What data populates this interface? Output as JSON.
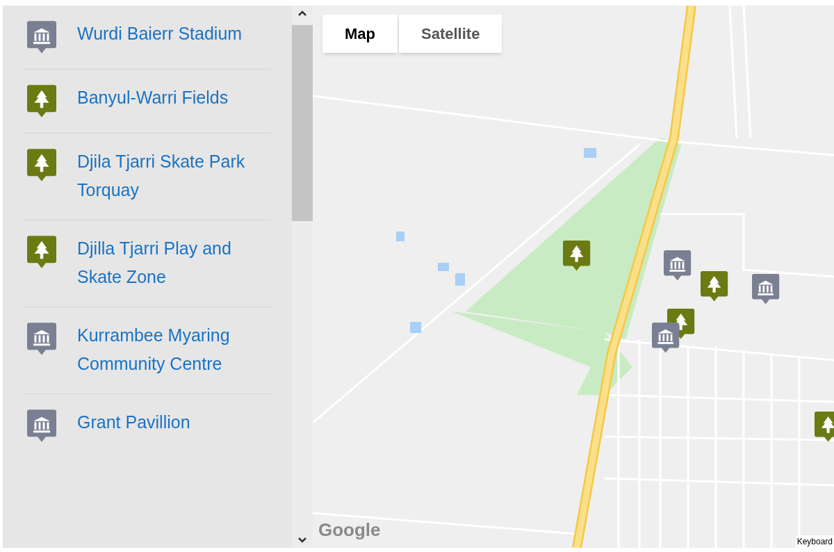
{
  "places": [
    {
      "name": "Wurdi Baierr Stadium",
      "kind": "building"
    },
    {
      "name": "Banyul-Warri Fields",
      "kind": "park"
    },
    {
      "name": "Djila Tjarri Skate Park Torquay",
      "kind": "park"
    },
    {
      "name": "Djilla Tjarri Play and Skate Zone",
      "kind": "park"
    },
    {
      "name": "Kurrambee Myaring Community Centre",
      "kind": "building"
    },
    {
      "name": "Grant Pavillion",
      "kind": "building"
    }
  ],
  "map": {
    "type_buttons": [
      {
        "label": "Map",
        "selected": true
      },
      {
        "label": "Satellite",
        "selected": false
      }
    ],
    "logo": "Google",
    "footer": "Keyboard"
  }
}
